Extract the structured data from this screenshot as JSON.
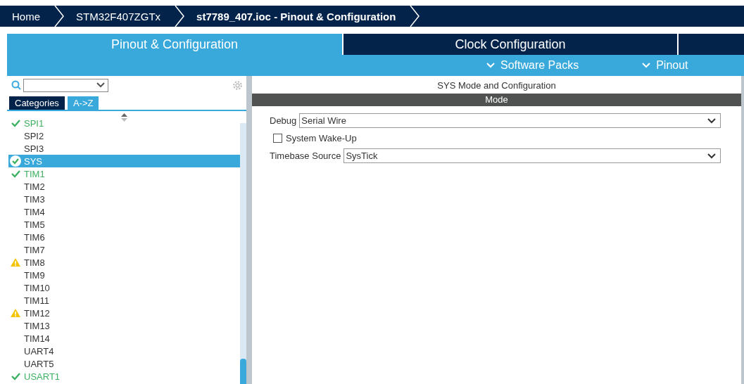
{
  "breadcrumbs": [
    {
      "label": "Home",
      "current": false
    },
    {
      "label": "STM32F407ZGTx",
      "current": false
    },
    {
      "label": "st7789_407.ioc - Pinout & Configuration",
      "current": true
    }
  ],
  "tabs": [
    {
      "label": "Pinout & Configuration",
      "selected": true
    },
    {
      "label": "Clock Configuration",
      "selected": false
    }
  ],
  "subtabs": [
    {
      "label": "Software Packs"
    },
    {
      "label": "Pinout"
    }
  ],
  "sidebar": {
    "view_tabs": [
      {
        "label": "Categories",
        "selected": false
      },
      {
        "label": "A->Z",
        "selected": true
      }
    ],
    "items": [
      {
        "label": "SPI1",
        "kind": "ok",
        "selected": false
      },
      {
        "label": "SPI2",
        "kind": "plain",
        "selected": false
      },
      {
        "label": "SPI3",
        "kind": "plain",
        "selected": false
      },
      {
        "label": "SYS",
        "kind": "ok",
        "selected": true
      },
      {
        "label": "TIM1",
        "kind": "ok",
        "selected": false
      },
      {
        "label": "TIM2",
        "kind": "plain",
        "selected": false
      },
      {
        "label": "TIM3",
        "kind": "plain",
        "selected": false
      },
      {
        "label": "TIM4",
        "kind": "plain",
        "selected": false
      },
      {
        "label": "TIM5",
        "kind": "plain",
        "selected": false
      },
      {
        "label": "TIM6",
        "kind": "plain",
        "selected": false
      },
      {
        "label": "TIM7",
        "kind": "plain",
        "selected": false
      },
      {
        "label": "TIM8",
        "kind": "warning",
        "selected": false
      },
      {
        "label": "TIM9",
        "kind": "plain",
        "selected": false
      },
      {
        "label": "TIM10",
        "kind": "plain",
        "selected": false
      },
      {
        "label": "TIM11",
        "kind": "plain",
        "selected": false
      },
      {
        "label": "TIM12",
        "kind": "warning",
        "selected": false
      },
      {
        "label": "TIM13",
        "kind": "plain",
        "selected": false
      },
      {
        "label": "TIM14",
        "kind": "plain",
        "selected": false
      },
      {
        "label": "UART4",
        "kind": "plain",
        "selected": false
      },
      {
        "label": "UART5",
        "kind": "plain",
        "selected": false
      },
      {
        "label": "USART1",
        "kind": "ok",
        "selected": false
      }
    ]
  },
  "panel": {
    "title": "SYS Mode and Configuration",
    "section": "Mode",
    "fields": [
      {
        "kind": "select",
        "label": "Debug",
        "value": "Serial Wire"
      },
      {
        "kind": "checkbox",
        "label": "System Wake-Up",
        "checked": false
      },
      {
        "kind": "select",
        "label": "Timebase Source",
        "value": "SysTick"
      }
    ]
  }
}
